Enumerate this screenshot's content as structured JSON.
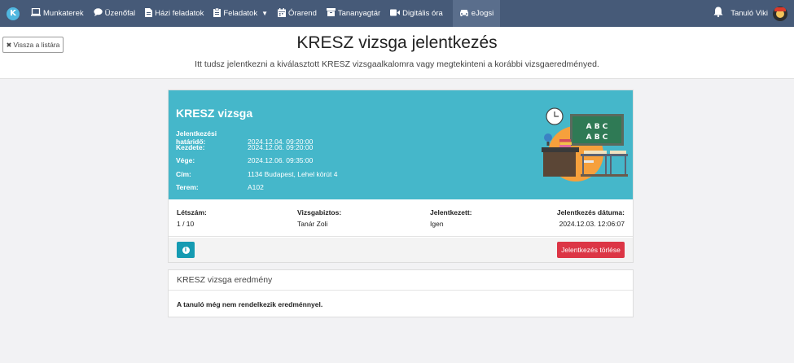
{
  "topbar": {
    "logo_letter": "K",
    "nav": [
      {
        "label": "Munkaterek",
        "icon": "laptop-icon"
      },
      {
        "label": "Üzenőfal",
        "icon": "chat-bubble-icon"
      },
      {
        "label": "Házi feladatok",
        "icon": "document-icon"
      },
      {
        "label": "Feladatok",
        "icon": "clipboard-icon"
      },
      {
        "label": "Órarend",
        "icon": "calendar-icon"
      },
      {
        "label": "Tananyagtár",
        "icon": "archive-icon"
      },
      {
        "label": "Digitális óra",
        "icon": "video-camera-icon"
      },
      {
        "label": "eJogsi",
        "icon": "car-icon"
      }
    ],
    "user_name": "Tanuló Viki"
  },
  "header": {
    "back_label": "Vissza a listára",
    "title": "KRESZ vizsga jelentkezés",
    "subtitle": "Itt tudsz jelentkezni a kiválasztott KRESZ vizsgaalkalomra vagy megtekinteni a korábbi vizsgaeredményed."
  },
  "exam": {
    "title": "KRESZ vizsga",
    "details": [
      {
        "label": "Jelentkezési határidő:",
        "value": "2024.12.04. 09:20:00"
      },
      {
        "label": "Kezdete:",
        "value": "2024.12.06. 09:20:00"
      },
      {
        "label": "Vége:",
        "value": "2024.12.06. 09:35:00"
      },
      {
        "label": "Cím:",
        "value": "1134 Budapest, Lehel körút 4"
      },
      {
        "label": "Terem:",
        "value": "A102"
      }
    ],
    "board_text": [
      "A B C",
      "A B C"
    ],
    "info": [
      {
        "label": "Létszám:",
        "value": "1 / 10"
      },
      {
        "label": "Vizsgabiztos:",
        "value": "Tanár Zoli"
      },
      {
        "label": "Jelentkezett:",
        "value": "Igen"
      },
      {
        "label": "Jelentkezés dátuma:",
        "value": "2024.12.03. 12:06:07"
      }
    ],
    "info_icon_glyph": "i",
    "cancel_label": "Jelentkezés törlése"
  },
  "result": {
    "title": "KRESZ vizsga eredmény",
    "message": "A tanuló még nem rendelkezik eredménnyel."
  },
  "colors": {
    "topbar": "#465a78",
    "card_header": "#45b7ca",
    "danger": "#dc3545",
    "info_button": "#159bb2"
  }
}
